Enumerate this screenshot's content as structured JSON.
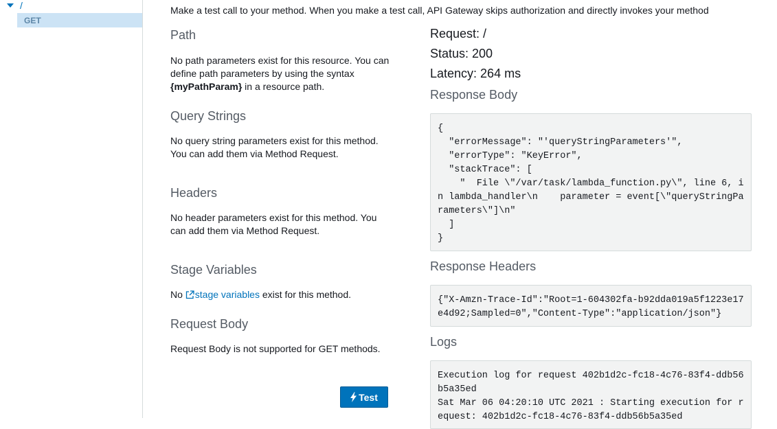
{
  "sidebar": {
    "root_label": "/",
    "method_label": "GET"
  },
  "intro": "Make a test call to your method. When you make a test call, API Gateway skips authorization and directly invokes your method",
  "sections": {
    "path": {
      "title": "Path",
      "text_before": "No path parameters exist for this resource. You can define path parameters by using the syntax ",
      "text_bold": "{myPathParam}",
      "text_after": " in a resource path."
    },
    "query": {
      "title": "Query Strings",
      "text": "No query string parameters exist for this method. You can add them via Method Request."
    },
    "headers": {
      "title": "Headers",
      "text": "No header parameters exist for this method. You can add them via Method Request."
    },
    "stage": {
      "title": "Stage Variables",
      "text_before": "No ",
      "link": "stage variables",
      "text_after": " exist for this method."
    },
    "body": {
      "title": "Request Body",
      "text": "Request Body is not supported for GET methods."
    }
  },
  "test_button": {
    "label": "Test"
  },
  "result": {
    "request": "Request: /",
    "status": "Status: 200",
    "latency": "Latency: 264 ms",
    "response_body_title": "Response Body",
    "response_body": "{\n  \"errorMessage\": \"'queryStringParameters'\",\n  \"errorType\": \"KeyError\",\n  \"stackTrace\": [\n    \"  File \\\"/var/task/lambda_function.py\\\", line 6, in lambda_handler\\n    parameter = event[\\\"queryStringParameters\\\"]\\n\"\n  ]\n}",
    "response_headers_title": "Response Headers",
    "response_headers": "{\"X-Amzn-Trace-Id\":\"Root=1-604302fa-b92dda019a5f1223e17e4d92;Sampled=0\",\"Content-Type\":\"application/json\"}",
    "logs_title": "Logs",
    "logs": "Execution log for request 402b1d2c-fc18-4c76-83f4-ddb56b5a35ed\nSat Mar 06 04:20:10 UTC 2021 : Starting execution for request: 402b1d2c-fc18-4c76-83f4-ddb56b5a35ed"
  },
  "colors": {
    "accent": "#0073bb",
    "selected_bg": "#cce3f5"
  }
}
